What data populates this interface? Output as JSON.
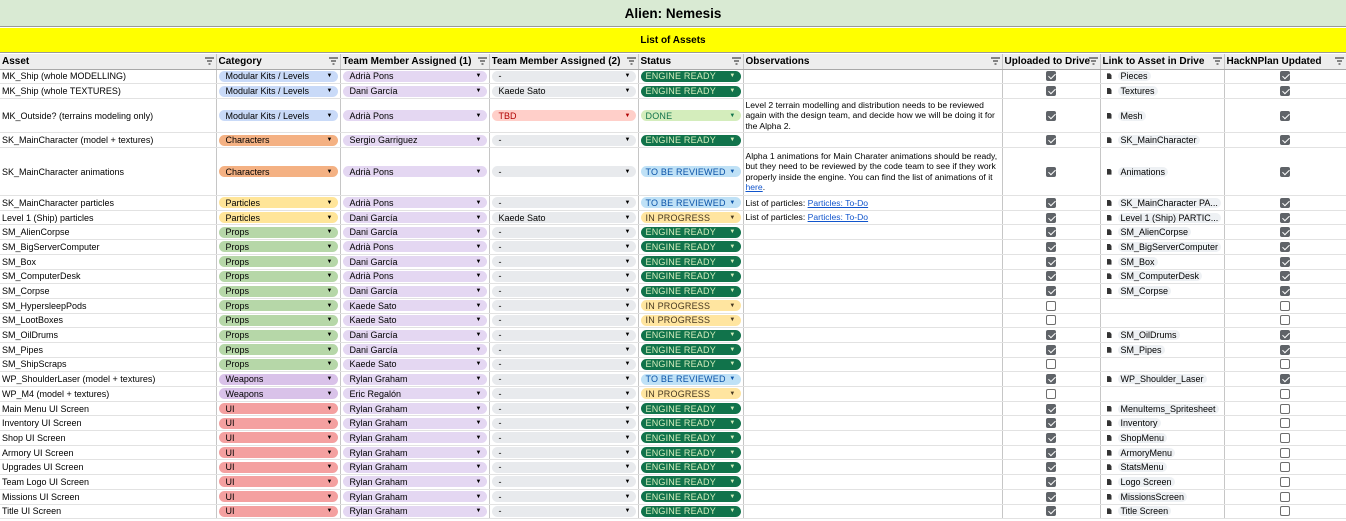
{
  "sheet": {
    "title": "Alien: Nemesis",
    "subtitle": "List of Assets"
  },
  "headers": [
    "Asset",
    "Category",
    "Team Member Assigned (1)",
    "Team Member Assigned (2)",
    "Status",
    "Observations",
    "Uploaded to Drive",
    "Link to Asset in Drive",
    "HackNPlan Updated"
  ],
  "colors": {
    "title_bg": "#d9ead3",
    "subtitle_bg": "#ffff00",
    "categories": {
      "Modular Kits / Levels": "#c9daf8",
      "Characters": "#f4b183",
      "Particles": "#ffe599",
      "Props": "#b6d7a8",
      "Weapons": "#d9c2e9",
      "UI": "#f4a0a0"
    },
    "status": {
      "ENGINE READY": [
        "#11734b",
        "#d4edbc"
      ],
      "DONE": [
        "#d4edbc",
        "#11734b"
      ],
      "TO BE REVIEWED": [
        "#bfe1f6",
        "#0a53a8"
      ],
      "IN PROGRESS": [
        "#ffe5a0",
        "#473821"
      ]
    },
    "member_chip": "#e4d7f2",
    "member2_chip": "#e8eaed",
    "tbd_chip": "#ffcfc9"
  },
  "rows": [
    {
      "asset": "MK_Ship (whole MODELLING)",
      "category": "Modular Kits / Levels",
      "member1": "Adrià Pons",
      "member2": "-",
      "status": "ENGINE READY",
      "obs": "",
      "uploaded": true,
      "link": "Pieces",
      "hnp": true
    },
    {
      "asset": "MK_Ship (whole TEXTURES)",
      "category": "Modular Kits / Levels",
      "member1": "Dani García",
      "member2": "Kaede Sato",
      "status": "ENGINE READY",
      "obs": "",
      "uploaded": true,
      "link": "Textures",
      "hnp": true
    },
    {
      "asset": "MK_Outside? (terrains modeling only)",
      "category": "Modular Kits / Levels",
      "member1": "Adrià Pons",
      "member2": "TBD",
      "status": "DONE",
      "obs": "Level 2 terrain modelling and distribution needs to be reviewed again with the design team, and decide how we will be doing it for the Alpha 2.",
      "uploaded": true,
      "link": "Mesh",
      "hnp": true,
      "tall": "tall2"
    },
    {
      "asset": "SK_MainCharacter (model + textures)",
      "category": "Characters",
      "member1": "Sergio Garriguez",
      "member2": "-",
      "status": "ENGINE READY",
      "obs": "",
      "uploaded": true,
      "link": "SK_MainCharacter",
      "hnp": true
    },
    {
      "asset": "SK_MainCharacter animations",
      "category": "Characters",
      "member1": "Adrià Pons",
      "member2": "-",
      "status": "TO BE REVIEWED",
      "obs": "Alpha 1 animations for Main Charater animations should be ready, but they need to be reviewed by the code team to see if they work properly inside the engine. You can find the list of animations of it ",
      "obs_link": "here",
      "obs_tail": ".",
      "uploaded": true,
      "link": "Animations",
      "hnp": true,
      "tall": "tall4"
    },
    {
      "asset": "SK_MainCharacter particles",
      "category": "Particles",
      "member1": "Adrià Pons",
      "member2": "-",
      "status": "TO BE REVIEWED",
      "obs": "List of particles: ",
      "obs_link": "Particles: To-Do",
      "uploaded": true,
      "link": "SK_MainCharacter PA...",
      "hnp": true
    },
    {
      "asset": "Level 1 (Ship) particles",
      "category": "Particles",
      "member1": "Dani García",
      "member2": "Kaede Sato",
      "status": "IN PROGRESS",
      "obs": "List of particles: ",
      "obs_link": "Particles: To-Do",
      "uploaded": true,
      "link": "Level 1 (Ship) PARTIC...",
      "hnp": true
    },
    {
      "asset": "SM_AlienCorpse",
      "category": "Props",
      "member1": "Dani García",
      "member2": "-",
      "status": "ENGINE READY",
      "obs": "",
      "uploaded": true,
      "link": "SM_AlienCorpse",
      "hnp": true
    },
    {
      "asset": "SM_BigServerComputer",
      "category": "Props",
      "member1": "Adrià Pons",
      "member2": "-",
      "status": "ENGINE READY",
      "obs": "",
      "uploaded": true,
      "link": "SM_BigServerComputer",
      "hnp": true
    },
    {
      "asset": "SM_Box",
      "category": "Props",
      "member1": "Dani García",
      "member2": "-",
      "status": "ENGINE READY",
      "obs": "",
      "uploaded": true,
      "link": "SM_Box",
      "hnp": true
    },
    {
      "asset": "SM_ComputerDesk",
      "category": "Props",
      "member1": "Adrià Pons",
      "member2": "-",
      "status": "ENGINE READY",
      "obs": "",
      "uploaded": true,
      "link": "SM_ComputerDesk",
      "hnp": true
    },
    {
      "asset": "SM_Corpse",
      "category": "Props",
      "member1": "Dani García",
      "member2": "-",
      "status": "ENGINE READY",
      "obs": "",
      "uploaded": true,
      "link": "SM_Corpse",
      "hnp": true
    },
    {
      "asset": "SM_HypersleepPods",
      "category": "Props",
      "member1": "Kaede Sato",
      "member2": "-",
      "status": "IN PROGRESS",
      "obs": "",
      "uploaded": false,
      "link": "",
      "hnp": false
    },
    {
      "asset": "SM_LootBoxes",
      "category": "Props",
      "member1": "Kaede Sato",
      "member2": "-",
      "status": "IN PROGRESS",
      "obs": "",
      "uploaded": false,
      "link": "",
      "hnp": false
    },
    {
      "asset": "SM_OilDrums",
      "category": "Props",
      "member1": "Dani García",
      "member2": "-",
      "status": "ENGINE READY",
      "obs": "",
      "uploaded": true,
      "link": "SM_OilDrums",
      "hnp": true
    },
    {
      "asset": "SM_Pipes",
      "category": "Props",
      "member1": "Dani García",
      "member2": "-",
      "status": "ENGINE READY",
      "obs": "",
      "uploaded": true,
      "link": "SM_Pipes",
      "hnp": true
    },
    {
      "asset": "SM_ShipScraps",
      "category": "Props",
      "member1": "Kaede Sato",
      "member2": "-",
      "status": "ENGINE READY",
      "obs": "",
      "uploaded": false,
      "link": "",
      "hnp": false
    },
    {
      "asset": "WP_ShoulderLaser (model + textures)",
      "category": "Weapons",
      "member1": "Rylan Graham",
      "member2": "-",
      "status": "TO BE REVIEWED",
      "obs": "",
      "uploaded": true,
      "link": "WP_Shoulder_Laser",
      "hnp": true
    },
    {
      "asset": "WP_M4 (model + textures)",
      "category": "Weapons",
      "member1": "Eric Regalón",
      "member2": "-",
      "status": "IN PROGRESS",
      "obs": "",
      "uploaded": false,
      "link": "",
      "hnp": false
    },
    {
      "asset": "Main Menu UI Screen",
      "category": "UI",
      "member1": "Rylan Graham",
      "member2": "-",
      "status": "ENGINE READY",
      "obs": "",
      "uploaded": true,
      "link": "MenuItems_Spritesheet",
      "hnp": false
    },
    {
      "asset": "Inventory UI Screen",
      "category": "UI",
      "member1": "Rylan Graham",
      "member2": "-",
      "status": "ENGINE READY",
      "obs": "",
      "uploaded": true,
      "link": "Inventory",
      "hnp": false
    },
    {
      "asset": "Shop UI Screen",
      "category": "UI",
      "member1": "Rylan Graham",
      "member2": "-",
      "status": "ENGINE READY",
      "obs": "",
      "uploaded": true,
      "link": "ShopMenu",
      "hnp": false
    },
    {
      "asset": "Armory UI Screen",
      "category": "UI",
      "member1": "Rylan Graham",
      "member2": "-",
      "status": "ENGINE READY",
      "obs": "",
      "uploaded": true,
      "link": "ArmoryMenu",
      "hnp": false
    },
    {
      "asset": "Upgrades UI Screen",
      "category": "UI",
      "member1": "Rylan Graham",
      "member2": "-",
      "status": "ENGINE READY",
      "obs": "",
      "uploaded": true,
      "link": "StatsMenu",
      "hnp": false
    },
    {
      "asset": "Team Logo UI Screen",
      "category": "UI",
      "member1": "Rylan Graham",
      "member2": "-",
      "status": "ENGINE READY",
      "obs": "",
      "uploaded": true,
      "link": "Logo Screen",
      "hnp": false
    },
    {
      "asset": "Missions UI Screen",
      "category": "UI",
      "member1": "Rylan Graham",
      "member2": "-",
      "status": "ENGINE READY",
      "obs": "",
      "uploaded": true,
      "link": "MissionsScreen",
      "hnp": false
    },
    {
      "asset": "Title UI Screen",
      "category": "UI",
      "member1": "Rylan Graham",
      "member2": "-",
      "status": "ENGINE READY",
      "obs": "",
      "uploaded": true,
      "link": "Title Screen",
      "hnp": false
    }
  ]
}
